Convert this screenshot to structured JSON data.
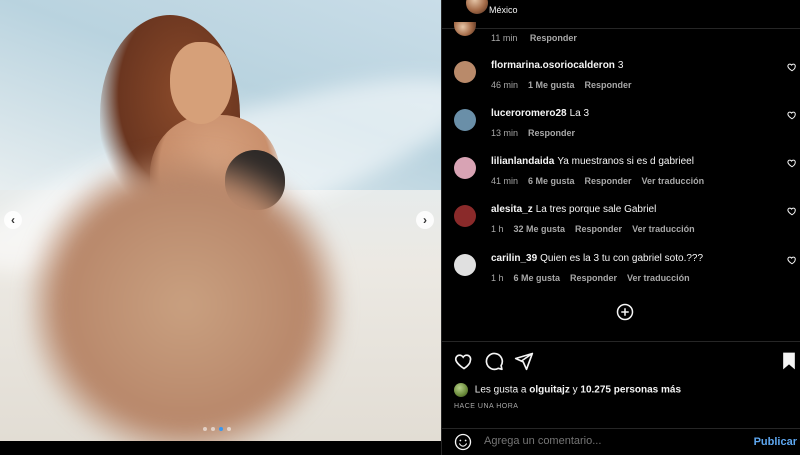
{
  "post": {
    "location": "México",
    "carousel": {
      "dot_count": 4,
      "active_index": 2,
      "prev_icon": "chevron-left-icon",
      "next_icon": "chevron-right-icon"
    }
  },
  "first_comment": {
    "time": "11 min",
    "reply": "Responder"
  },
  "comments": [
    {
      "username": "flormarina.osoriocalderon",
      "text": "3",
      "time": "46 min",
      "likes": "1 Me gusta",
      "reply": "Responder",
      "translate": "",
      "avatar_color": "#b98a6a"
    },
    {
      "username": "luceroromero28",
      "text": "La 3",
      "time": "13 min",
      "likes": "",
      "reply": "Responder",
      "translate": "",
      "avatar_color": "#6a8fa8"
    },
    {
      "username": "lilianlandaida",
      "text": "Ya muestranos si es d gabrieel",
      "time": "41 min",
      "likes": "6 Me gusta",
      "reply": "Responder",
      "translate": "Ver traducción",
      "avatar_color": "#d8a3b4"
    },
    {
      "username": "alesita_z",
      "text": "La tres porque sale Gabriel",
      "time": "1 h",
      "likes": "32 Me gusta",
      "reply": "Responder",
      "translate": "Ver traducción",
      "avatar_color": "#8a2a2a"
    },
    {
      "username": "carilin_39",
      "text": "Quien es la 3 tu con gabriel soto.???",
      "time": "1 h",
      "likes": "6 Me gusta",
      "reply": "Responder",
      "translate": "Ver traducción",
      "avatar_color": "#e0e0e0"
    }
  ],
  "likes_line": {
    "prefix": "Les gusta a",
    "user": "olguitajz",
    "joiner": "y",
    "others": "10.275 personas más"
  },
  "time_ago": "HACE UNA HORA",
  "add_comment": {
    "placeholder": "Agrega un comentario...",
    "publish": "Publicar"
  },
  "icons": {
    "like": "heart-icon",
    "comment": "comment-icon",
    "share": "share-icon",
    "save": "bookmark-icon",
    "load_more": "plus-circle-icon",
    "emoji": "emoji-icon"
  }
}
